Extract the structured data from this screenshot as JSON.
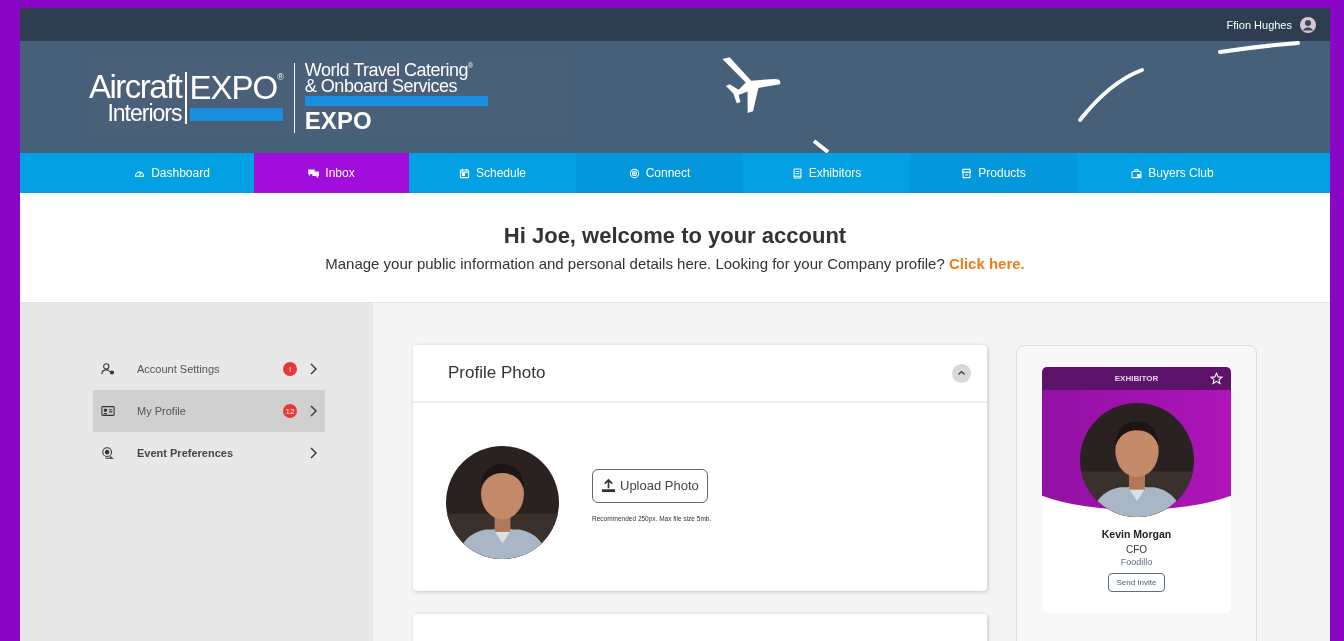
{
  "top_bar": {
    "user_name": "Ffion Hughes"
  },
  "logo": {
    "aircraft": "Aircraft",
    "interiors": "Interiors",
    "expo_left": "EXPO",
    "registered_left": "®",
    "wtc_line1": "World Travel Catering",
    "wtc_line2": "& Onboard Services",
    "registered_right": "®",
    "expo_right": "EXPO"
  },
  "nav": [
    {
      "label": "Dashboard",
      "selected": false
    },
    {
      "label": "Inbox",
      "selected": true
    },
    {
      "label": "Schedule",
      "selected": false
    },
    {
      "label": "Connect",
      "selected": false
    },
    {
      "label": "Exhibitors",
      "selected": false
    },
    {
      "label": "Products",
      "selected": false
    },
    {
      "label": "Buyers Club",
      "selected": false
    }
  ],
  "welcome": {
    "title": "Hi Joe, welcome to your account",
    "text": "Manage your public information and personal details here. Looking for your Company profile?",
    "link": "Click here."
  },
  "sidebar": [
    {
      "label": "Account Settings",
      "badge": "!",
      "bold": false,
      "selected": false
    },
    {
      "label": "My Profile",
      "badge": "12",
      "bold": false,
      "selected": true
    },
    {
      "label": "Event Preferences",
      "bold": true,
      "selected": false
    }
  ],
  "profile_photo": {
    "title": "Profile Photo",
    "expanded": true,
    "button": "Upload Photo",
    "hint": "Recommended 250px. Max file size 5mb."
  },
  "preview_card": {
    "kind": "EXHIBITOR",
    "starred": false,
    "name": "Kevin Morgan",
    "role": "CFO",
    "company": "Foodillo",
    "button": "Send Invite"
  }
}
